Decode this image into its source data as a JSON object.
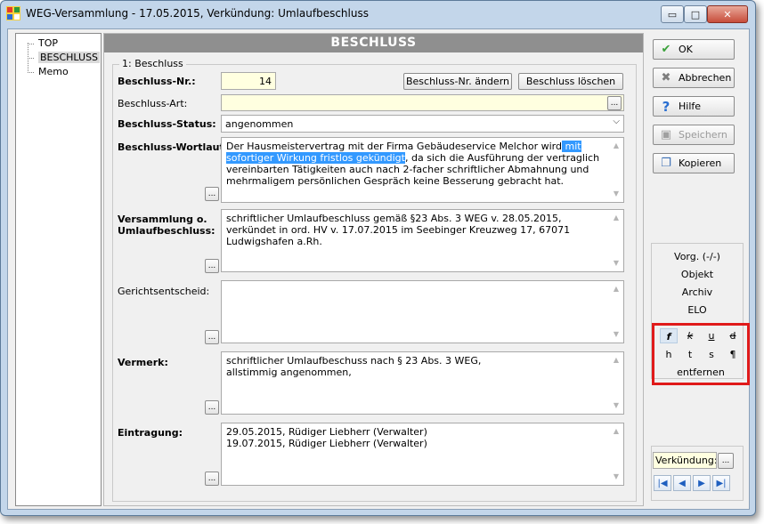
{
  "window": {
    "title": "WEG-Versammlung - 17.05.2015,  Verkündung: Umlaufbeschluss",
    "min_label": "▭",
    "max_label": "□",
    "close_label": "✕"
  },
  "tree": {
    "items": [
      "TOP",
      "BESCHLUSS",
      "Memo"
    ],
    "selected": "BESCHLUSS"
  },
  "panel": {
    "header": "BESCHLUSS",
    "group_title": "1: Beschluss",
    "nr_label": "Beschluss-Nr.:",
    "nr_value": "14",
    "change_nr_button": "Beschluss-Nr. ändern",
    "delete_button": "Beschluss löschen",
    "art_label": "Beschluss-Art:",
    "art_value": "",
    "status_label": "Beschluss-Status:",
    "status_value": "angenommen",
    "wortlaut_label": "Beschluss-Wortlaut:",
    "wortlaut_pre": "Der Hausmeistervertrag mit der Firma Gebäudeservice Melchor wird",
    "wortlaut_sel1": " mit sofortiger ",
    "wortlaut_sel2": "Wirkung fristlos gekündigt",
    "wortlaut_post": ", da sich die Ausführung der vertraglich vereinbarten Tätigkeiten auch nach 2-facher schriftlicher Abmahnung und mehrmaligem persönlichen Gespräch keine Besserung gebracht hat.",
    "versammlung_label_1": "Versammlung o.",
    "versammlung_label_2": "Umlaufbeschluss:",
    "versammlung_text": "schriftlicher Umlaufbeschluss gemäß §23 Abs. 3 WEG v. 28.05.2015, verkündet in ord. HV v. 17.07.2015 im Seebinger Kreuzweg 17, 67071 Ludwigshafen a.Rh.",
    "gericht_label": "Gerichtsentscheid:",
    "gericht_text": "",
    "vermerk_label": "Vermerk:",
    "vermerk_line1": "schriftlicher Umlaufbeschuss nach § 23 Abs. 3 WEG,",
    "vermerk_line2": "allstimmig angenommen,",
    "eintragung_label": "Eintragung:",
    "eintragung_line1": "29.05.2015, Rüdiger Liebherr (Verwalter)",
    "eintragung_line2": "19.07.2015, Rüdiger Liebherr (Verwalter)",
    "dots": "..."
  },
  "actions": {
    "ok": "OK",
    "abbrechen": "Abbrechen",
    "hilfe": "Hilfe",
    "speichern": "Speichern",
    "kopieren": "Kopieren"
  },
  "side": {
    "vorg": "Vorg. (-/-)",
    "objekt": "Objekt",
    "archiv": "Archiv",
    "elo": "ELO"
  },
  "format": {
    "bold": "f",
    "italic": "k",
    "underline": "u",
    "strike": "d",
    "high": "h",
    "low": "t",
    "s": "s",
    "para": "¶",
    "remove": "entfernen"
  },
  "nav": {
    "field_value": "Verkündung: U",
    "dots": "...",
    "first": "|◀",
    "prev": "◀",
    "next": "▶",
    "last": "▶|"
  },
  "colors": {
    "selection": "#3399ff",
    "highlight_frame": "#e01a1a",
    "header_bg": "#8f8f8f"
  }
}
